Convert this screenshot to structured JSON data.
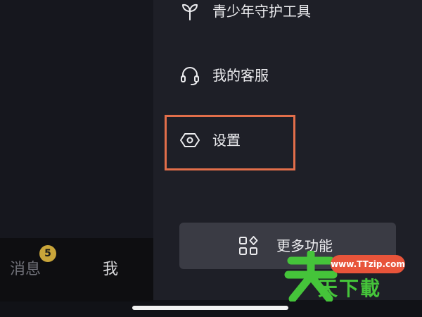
{
  "drawer": {
    "items": [
      {
        "label": "青少年守护工具",
        "icon": "sprout-icon"
      },
      {
        "label": "我的客服",
        "icon": "headset-icon"
      },
      {
        "label": "设置",
        "icon": "settings-hexagon-icon"
      }
    ],
    "more_button": {
      "label": "更多功能",
      "icon": "apps-grid-icon"
    }
  },
  "bottom_nav": {
    "messages_label": "消息",
    "messages_badge": "5",
    "me_label": "我"
  },
  "watermark": {
    "url": "www.TTzip.com",
    "text": "天下載"
  },
  "colors": {
    "highlight": "#e26e4a",
    "badge": "#c9a53a",
    "watermark_green": "#45c43a",
    "watermark_orange": "#e8543a"
  }
}
